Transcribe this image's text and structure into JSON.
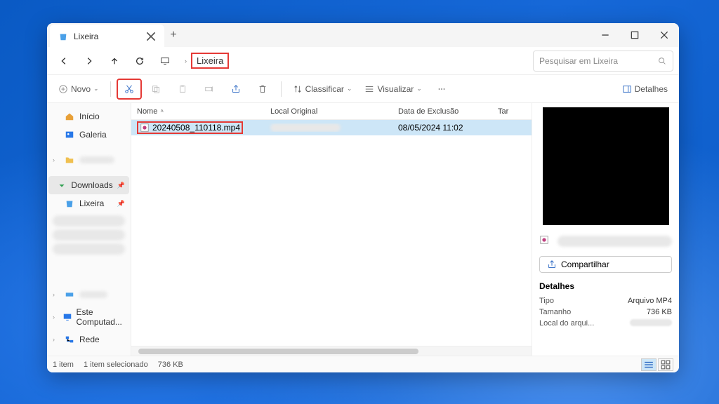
{
  "tab": {
    "title": "Lixeira"
  },
  "breadcrumb": {
    "current": "Lixeira"
  },
  "search": {
    "placeholder": "Pesquisar em Lixeira"
  },
  "toolbar": {
    "new": "Novo",
    "sort": "Classificar",
    "view": "Visualizar",
    "details": "Detalhes"
  },
  "sidebar": {
    "home": "Início",
    "gallery": "Galeria",
    "downloads": "Downloads",
    "recycle": "Lixeira",
    "thispc": "Este Computad...",
    "network": "Rede"
  },
  "columns": {
    "name": "Nome",
    "original": "Local Original",
    "deleted": "Data de Exclusão",
    "size": "Tar"
  },
  "files": [
    {
      "name": "20240508_110118.mp4",
      "deleted": "08/05/2024 11:02"
    }
  ],
  "preview": {
    "share": "Compartilhar",
    "details_title": "Detalhes",
    "rows": {
      "type_label": "Tipo",
      "type_value": "Arquivo MP4",
      "size_label": "Tamanho",
      "size_value": "736 KB",
      "loc_label": "Local do arqui..."
    }
  },
  "status": {
    "count": "1 item",
    "selected": "1 item selecionado",
    "size": "736 KB"
  }
}
